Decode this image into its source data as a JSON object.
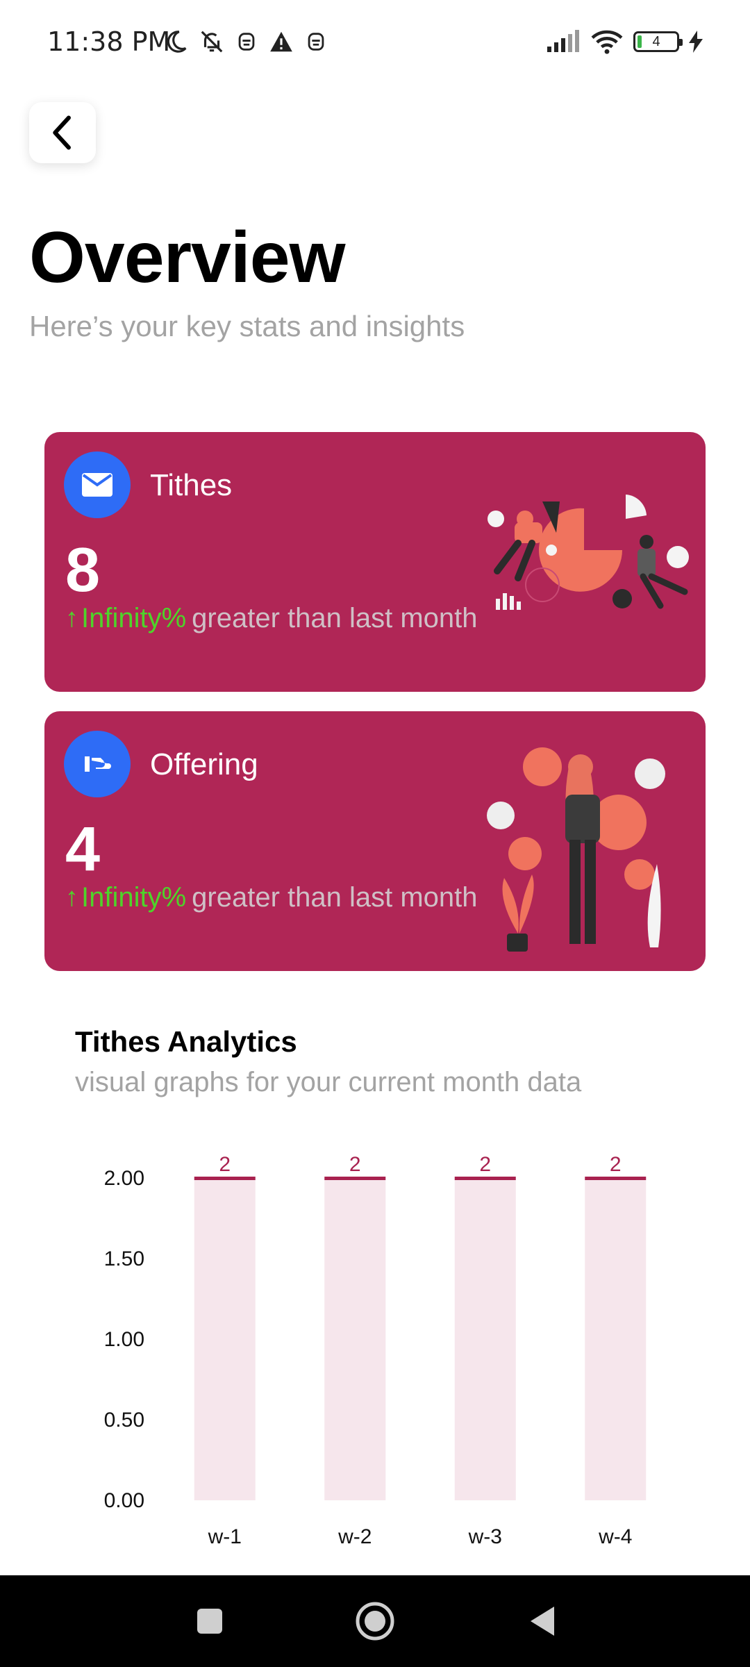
{
  "status_bar": {
    "time": "11:38 PM",
    "battery_level": "4"
  },
  "header": {
    "title": "Overview",
    "subtitle": "Here’s your key stats and insights"
  },
  "cards": [
    {
      "label": "Tithes",
      "value": "8",
      "trend_arrow": "↑",
      "trend_pct": "Infinity%",
      "trend_text": "greater than last month",
      "icon": "envelope-icon"
    },
    {
      "label": "Offering",
      "value": "4",
      "trend_arrow": "↑",
      "trend_pct": "Infinity%",
      "trend_text": "greater than last month",
      "icon": "hand-offering-icon"
    }
  ],
  "analytics": {
    "title": "Tithes Analytics",
    "subtitle": "visual graphs for your current month data"
  },
  "chart_data": {
    "type": "bar",
    "categories": [
      "w-1",
      "w-2",
      "w-3",
      "w-4"
    ],
    "values": [
      2,
      2,
      2,
      2
    ],
    "data_labels": [
      "2",
      "2",
      "2",
      "2"
    ],
    "y_ticks": [
      "0.00",
      "0.50",
      "1.00",
      "1.50",
      "2.00"
    ],
    "ylim": [
      0,
      2
    ],
    "grid": false,
    "bar_fill": "#f6e6ec",
    "bar_top": "#a8214f",
    "label_color": "#a8214f"
  },
  "colors": {
    "card_bg": "#b02656",
    "icon_bg": "#2e6cf6",
    "trend_green": "#4ed42a"
  }
}
